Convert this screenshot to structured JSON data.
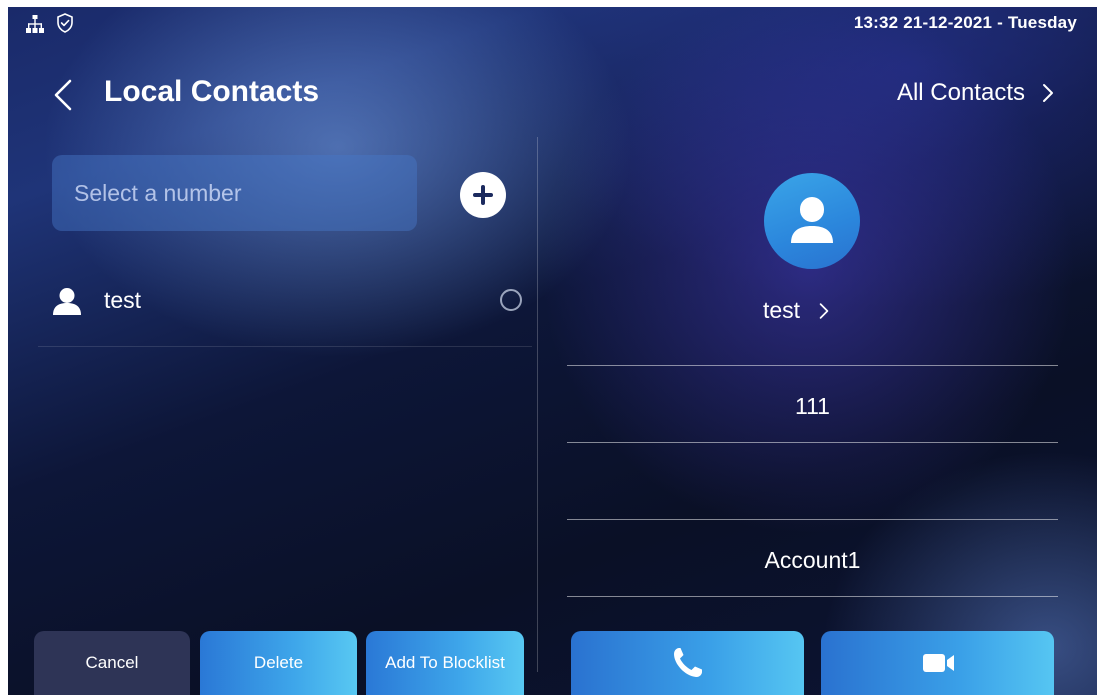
{
  "status_bar": {
    "clock": "13:32  21-12-2021 - Tuesday",
    "icons": [
      "network-icon",
      "shield-check-icon"
    ]
  },
  "header": {
    "title": "Local Contacts",
    "right_link": "All Contacts"
  },
  "search": {
    "placeholder": "Select a number"
  },
  "contacts": [
    {
      "name": "test",
      "selected": false
    }
  ],
  "detail": {
    "name": "test",
    "fields": [
      "111",
      "",
      "Account1"
    ]
  },
  "buttons": {
    "cancel": "Cancel",
    "delete": "Delete",
    "add_to_blocklist": "Add To Blocklist",
    "call_icon": "phone-icon",
    "video_icon": "video-camera-icon"
  },
  "colors": {
    "accent": "#3ea6ea",
    "cancel_bg": "#2e3456",
    "background": "#0a1026"
  }
}
